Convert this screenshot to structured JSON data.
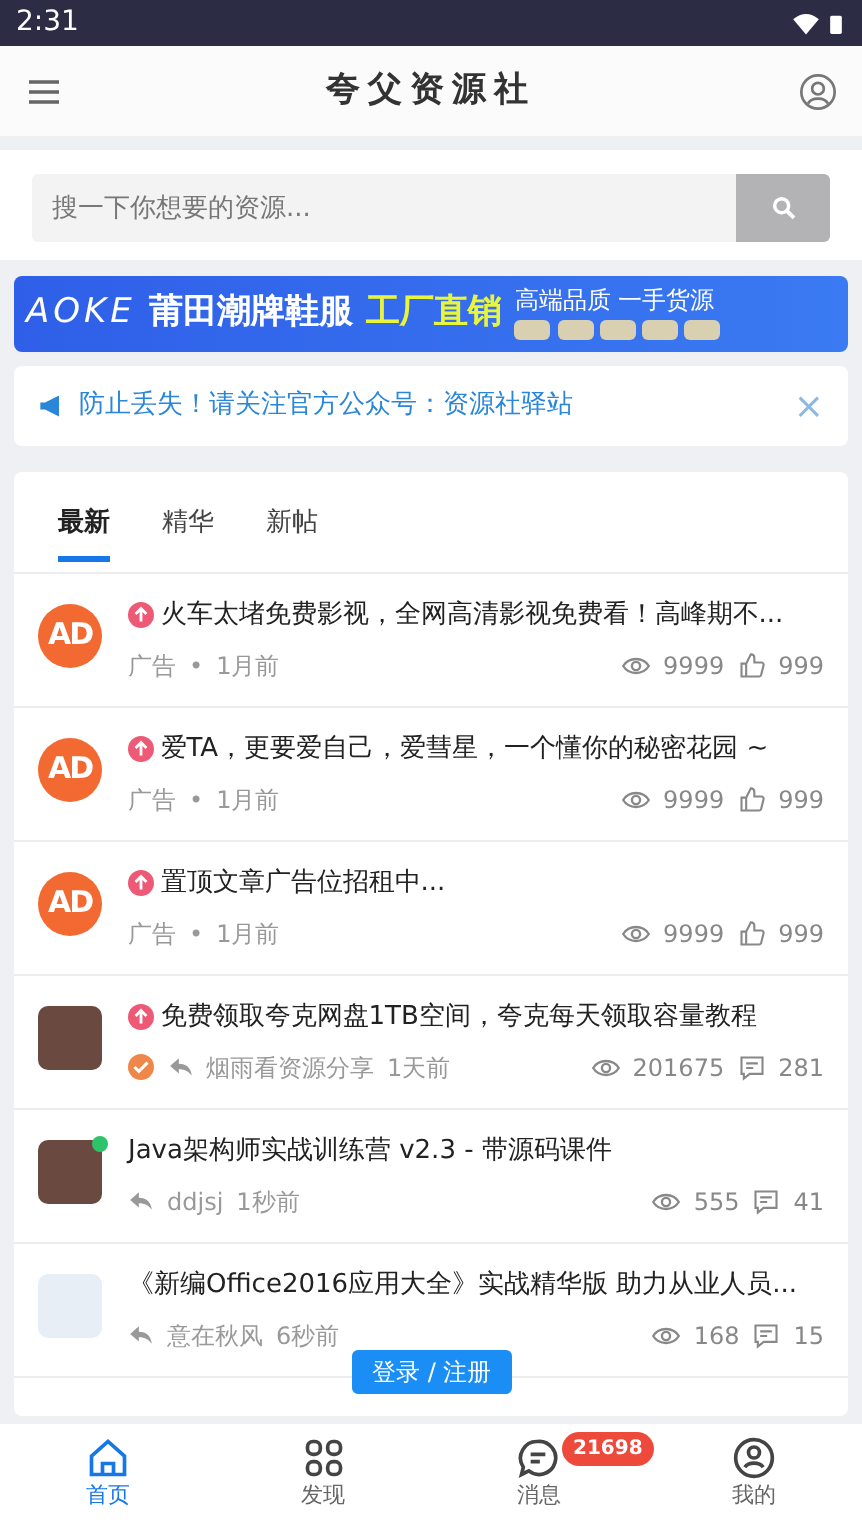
{
  "status_bar": {
    "time": "2:31"
  },
  "header": {
    "title": "夸父资源社"
  },
  "search": {
    "placeholder": "搜一下你想要的资源..."
  },
  "banner": {
    "brand": "AOKE",
    "headline": "莆田潮牌鞋服",
    "highlight": "工厂直销",
    "tagline": "高端品质 一手货源"
  },
  "notice": {
    "text": "防止丢失！请关注官方公众号：资源社驿站",
    "close": "×"
  },
  "tabs": [
    {
      "label": "最新",
      "selected": true
    },
    {
      "label": "精华",
      "selected": false
    },
    {
      "label": "新帖",
      "selected": false
    }
  ],
  "posts": [
    {
      "kind": "ad",
      "avatar_text": "AD",
      "pinned": true,
      "title": "火车太堵免费影视，全网高清影视免费看！高峰期不...",
      "author": "广告",
      "separator": "•",
      "time": "1月前",
      "verified": false,
      "reply": false,
      "online": false,
      "views": "9999",
      "likes": "999"
    },
    {
      "kind": "ad",
      "avatar_text": "AD",
      "pinned": true,
      "title": "爱TA，更要爱自己，爱彗星，一个懂你的秘密花园 ~",
      "author": "广告",
      "separator": "•",
      "time": "1月前",
      "verified": false,
      "reply": false,
      "online": false,
      "views": "9999",
      "likes": "999"
    },
    {
      "kind": "ad",
      "avatar_text": "AD",
      "pinned": true,
      "title": "置顶文章广告位招租中...",
      "author": "广告",
      "separator": "•",
      "time": "1月前",
      "verified": false,
      "reply": false,
      "online": false,
      "views": "9999",
      "likes": "999"
    },
    {
      "kind": "user",
      "pinned": true,
      "title": "免费领取夸克网盘1TB空间，夸克每天领取容量教程",
      "author": "烟雨看资源分享",
      "time": "1天前",
      "verified": true,
      "reply": true,
      "online": false,
      "views": "201675",
      "comments": "281"
    },
    {
      "kind": "user",
      "pinned": false,
      "title": "Java架构师实战训练营 v2.3 - 带源码课件",
      "author": "ddjsj",
      "time": "1秒前",
      "verified": false,
      "reply": true,
      "online": true,
      "views": "555",
      "comments": "41"
    },
    {
      "kind": "user",
      "pinned": false,
      "title": "《新编Office2016应用大全》实战精华版 助力从业人员...",
      "author": "意在秋风",
      "time": "6秒前",
      "verified": false,
      "reply": true,
      "online": false,
      "views": "168",
      "comments": "15"
    }
  ],
  "login_button": "登录 / 注册",
  "bottom_nav": [
    {
      "label": "首页",
      "selected": true
    },
    {
      "label": "发现",
      "selected": false
    },
    {
      "label": "消息",
      "selected": false,
      "badge": "21698"
    },
    {
      "label": "我的",
      "selected": false
    }
  ]
}
